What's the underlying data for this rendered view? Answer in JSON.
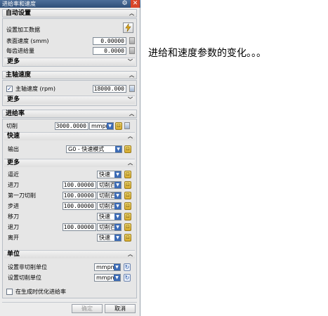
{
  "window": {
    "title": "进给率和速度",
    "close_glyph": "✕",
    "gear_glyph": "⚙"
  },
  "auto_settings": {
    "header": "自动设置",
    "set_machining_data": "设置加工数据",
    "surface_speed_label": "表面速度 (smm)",
    "surface_speed_value": "0.00000",
    "feed_per_tooth_label": "每齿进给量",
    "feed_per_tooth_value": "0.0000",
    "more_label": "更多"
  },
  "spindle": {
    "header": "主轴速度",
    "checkbox_label": "主轴速度 (rpm)",
    "checked": true,
    "value": "18000.000",
    "more_label": "更多"
  },
  "feed": {
    "header": "进给率",
    "cut_label": "切削",
    "cut_value": "3000.0000",
    "cut_unit": "mmpm",
    "rapid": {
      "header": "快速",
      "output_label": "输出",
      "output_value": "G0 - 快速模式"
    },
    "more": {
      "header": "更多",
      "rows": [
        {
          "label": "逼近",
          "value": "",
          "mode": "快速"
        },
        {
          "label": "进刀",
          "value": "100.00000",
          "mode": "切削百"
        },
        {
          "label": "第一刀切削",
          "value": "100.00000",
          "mode": "切削百"
        },
        {
          "label": "步进",
          "value": "100.00000",
          "mode": "切削百"
        },
        {
          "label": "移刀",
          "value": "",
          "mode": "快速"
        },
        {
          "label": "退刀",
          "value": "100.00000",
          "mode": "切削百"
        },
        {
          "label": "离开",
          "value": "",
          "mode": "快速"
        }
      ]
    },
    "units": {
      "header": "单位",
      "non_cut_label": "设置非切削单位",
      "non_cut_value": "mmpm",
      "cut_label": "设置切削单位",
      "cut_value": "mmpm"
    },
    "optimize_label": "在生成时优化进给率",
    "optimize_checked": false
  },
  "buttons": {
    "ok": "确定",
    "cancel": "取消"
  },
  "caption": "进给和速度参数的变化。。。"
}
